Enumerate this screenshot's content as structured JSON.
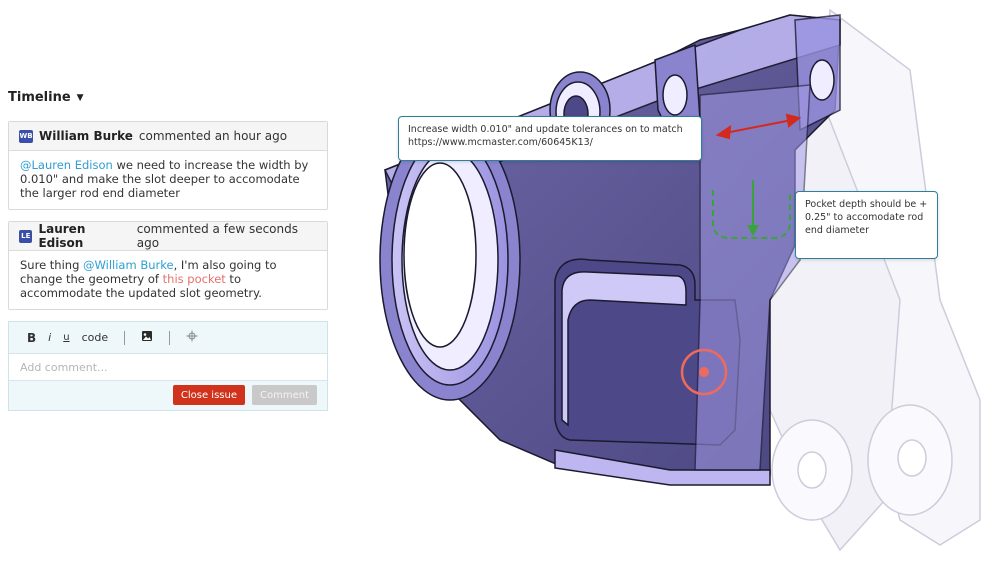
{
  "timeline": {
    "title": "Timeline"
  },
  "comments": [
    {
      "initials": "WB",
      "author": "William Burke",
      "action": "commented an hour ago",
      "mention": "@Lauren Edison",
      "text": " we need to increase the width by 0.010\" and make the slot deeper to accomodate the larger rod end diameter"
    },
    {
      "initials": "LE",
      "author": "Lauren Edison",
      "action": "commented a few seconds ago",
      "text_before": "Sure thing ",
      "mention": "@William Burke",
      "text_middle": ", I'm also going to change the geometry of ",
      "link": "this pocket",
      "text_after": " to accommodate the updated slot geometry."
    }
  ],
  "composer": {
    "toolbar": {
      "bold": "B",
      "italic": "i",
      "underline": "u",
      "code": "code"
    },
    "placeholder": "Add comment...",
    "close_label": "Close issue",
    "comment_label": "Comment"
  },
  "annotations": {
    "width": "Increase width 0.010\" and update tolerances on to match https://www.mcmaster.com/60645K13/",
    "pocket": "Pocket depth should be + 0.25\" to accomodate rod end diameter"
  },
  "colors": {
    "accent_mention": "#2d9fd3",
    "link_pocket": "#e4716a",
    "close_button": "#d1321c",
    "annotation_border": "#2e7f9c",
    "part_face": "#9a8fe0",
    "marker": "#ee6a5e",
    "measure_arrow": "#d42a1e",
    "depth_dashes": "#3aa33a"
  }
}
